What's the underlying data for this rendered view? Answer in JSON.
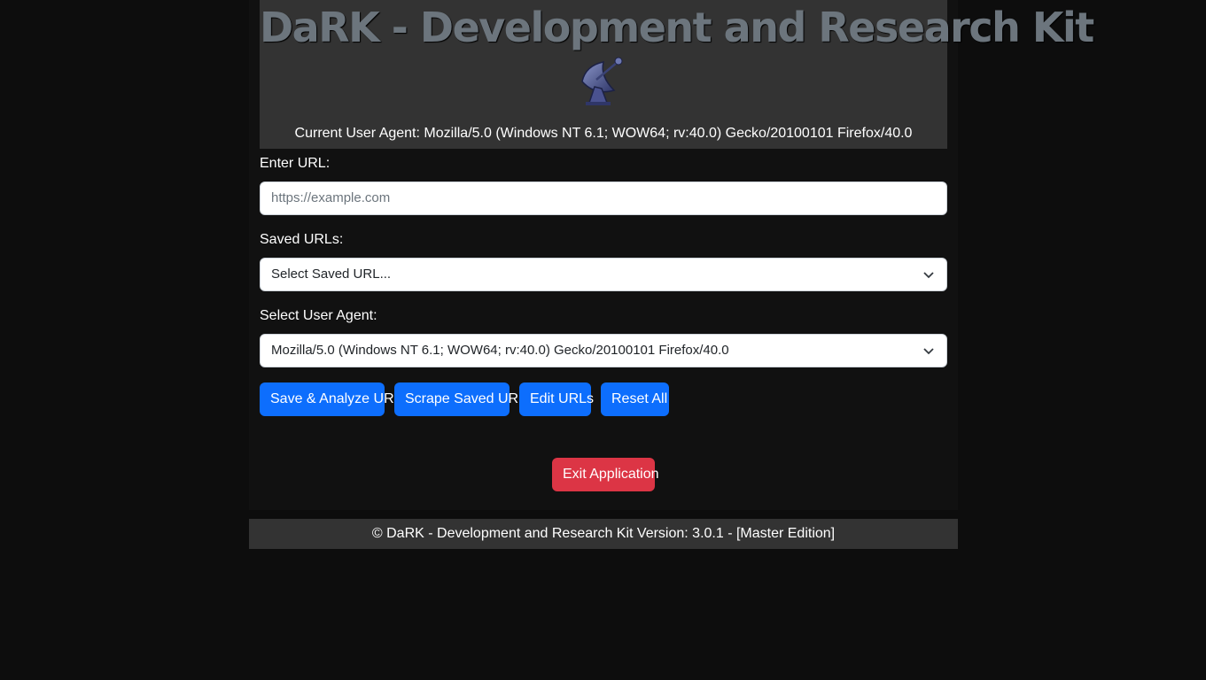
{
  "header": {
    "title": "DaRK - Development and Research Kit",
    "logo_icon": "satellite-dish-icon",
    "current_ua_label": "Current User Agent:",
    "current_ua_value": "Mozilla/5.0 (Windows NT 6.1; WOW64; rv:40.0) Gecko/20100101 Firefox/40.0"
  },
  "form": {
    "url_label": "Enter URL:",
    "url_placeholder": "https://example.com",
    "url_value": "",
    "saved_label": "Saved URLs:",
    "saved_selected": "Select Saved URL...",
    "ua_label": "Select User Agent:",
    "ua_selected": "Mozilla/5.0 (Windows NT 6.1; WOW64; rv:40.0) Gecko/20100101 Firefox/40.0"
  },
  "buttons": {
    "save_analyze": "Save & Analyze URL",
    "scrape_saved": "Scrape Saved URL",
    "edit_urls": "Edit URLs",
    "reset_all": "Reset All",
    "exit": "Exit Application"
  },
  "footer": {
    "text": "© DaRK - Development and Research Kit Version: 3.0.1 - [Master Edition]"
  },
  "colors": {
    "primary": "#0d6efd",
    "danger": "#dc3545",
    "header_bg": "#333333",
    "title": "#6c757d"
  }
}
